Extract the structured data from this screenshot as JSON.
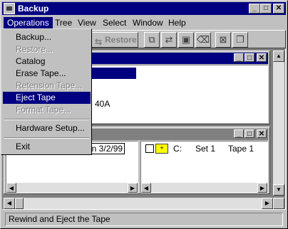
{
  "window": {
    "title": "Backup"
  },
  "menubar": [
    {
      "label": "Operations"
    },
    {
      "label": "Tree"
    },
    {
      "label": "View"
    },
    {
      "label": "Select"
    },
    {
      "label": "Window"
    },
    {
      "label": "Help"
    }
  ],
  "toolbar": {
    "restore_label": "Restore"
  },
  "operations_menu": {
    "backup": "Backup...",
    "restore": "Restore...",
    "catalog": "Catalog",
    "erase_tape": "Erase Tape...",
    "retension_tape": "Retension Tape...",
    "eject_tape": "Eject Tape",
    "format_tape": "Format Tape...",
    "hardware_setup": "Hardware Setup...",
    "exit": "Exit"
  },
  "drives_window": {
    "partial_text": "40A"
  },
  "tapes_window": {
    "left_partial_text": "on 3/2/99",
    "entry": {
      "drive": "C:",
      "set": "Set 1",
      "tape": "Tape 1"
    }
  },
  "statusbar": {
    "text": "Rewind and Eject the Tape"
  }
}
